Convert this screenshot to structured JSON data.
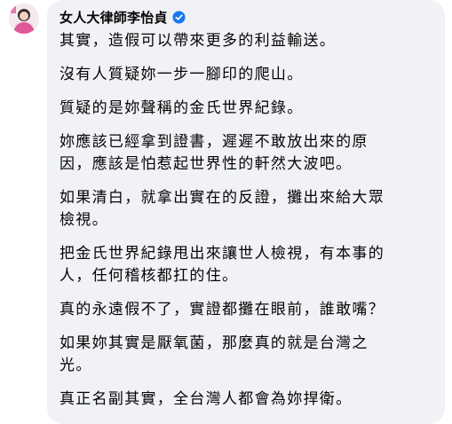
{
  "post": {
    "author_name": "女人大律師李怡貞",
    "paragraphs": [
      "其實，造假可以帶來更多的利益輸送。",
      "沒有人質疑妳一步一腳印的爬山。",
      "質疑的是妳聲稱的金氏世界紀錄。",
      "妳應該已經拿到證書，遲遲不敢放出來的原\n因，應該是怕惹起世界性的軒然大波吧。",
      "如果清白，就拿出實在的反證，攤出來給大眾\n檢視。",
      "把金氏世界紀錄甩出來讓世人檢視，有本事的\n人，任何稽核都扛的住。",
      "真的永遠假不了，實證都攤在眼前，誰敢嘴？",
      "如果妳其實是厭氧菌，那麼真的就是台灣之\n光。",
      "真正名副其實，全台灣人都會為妳捍衛。"
    ]
  },
  "icons": {
    "verified": "verified-badge-icon",
    "avatar": "profile-avatar"
  },
  "colors": {
    "bubble_bg": "#f0f2f5",
    "text": "#050505",
    "verified_blue": "#1877f2"
  }
}
